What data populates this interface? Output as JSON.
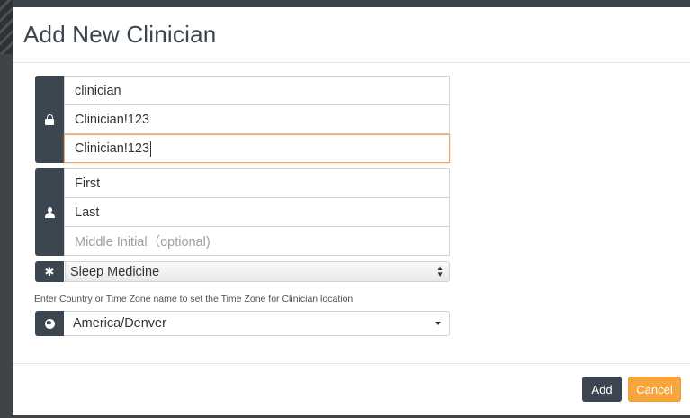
{
  "modal": {
    "title": "Add New Clinician"
  },
  "credentials": {
    "icon": "lock-icon",
    "username": "clinician",
    "password": "Clinician!123",
    "confirm_password": "Clinician!123"
  },
  "name": {
    "icon": "user-icon",
    "first": "First",
    "last": "Last",
    "middle_placeholder": "Middle Initial（optional)"
  },
  "specialty": {
    "icon": "asterisk-icon",
    "selected": "Sleep Medicine"
  },
  "timezone": {
    "hint": "Enter Country or Time Zone name to set the Time Zone for Clinician location",
    "icon": "globe-icon",
    "selected": "America/Denver"
  },
  "buttons": {
    "add": "Add",
    "cancel": "Cancel"
  },
  "colors": {
    "addon": "#3c4650",
    "focus_border": "#f0a560",
    "cancel": "#f7a53c"
  }
}
